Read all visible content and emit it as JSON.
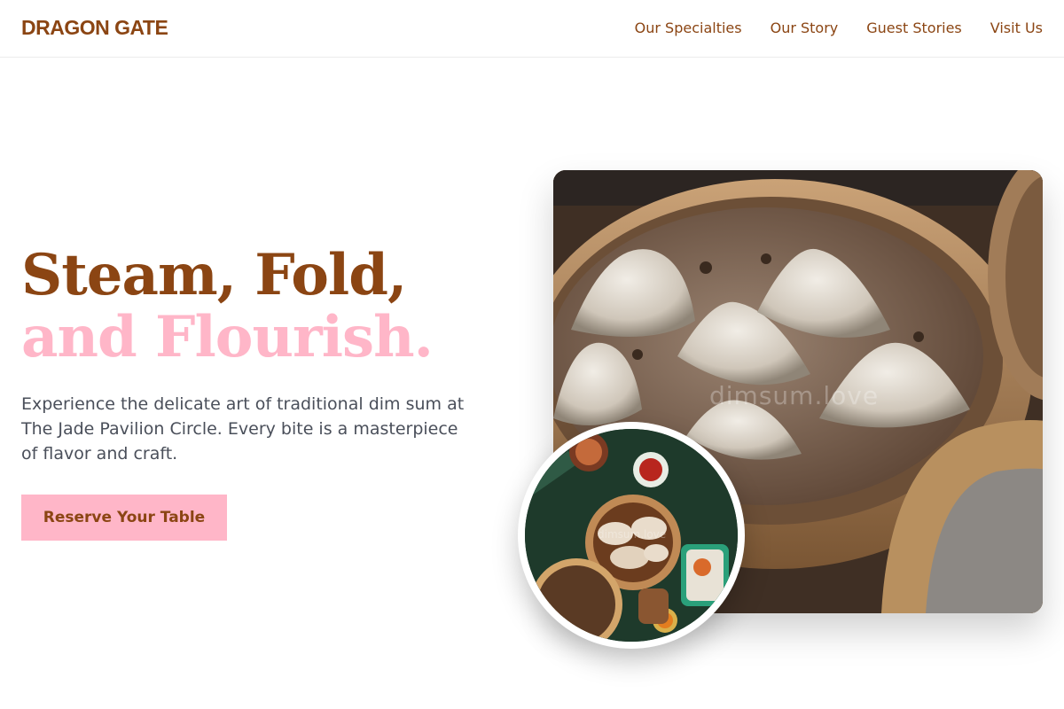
{
  "brand": {
    "name": "DRAGON GATE"
  },
  "nav": {
    "items": [
      {
        "label": "Our Specialties"
      },
      {
        "label": "Our Story"
      },
      {
        "label": "Guest Stories"
      },
      {
        "label": "Visit Us"
      }
    ]
  },
  "hero": {
    "headline_line1": "Steam, Fold,",
    "headline_line2": "and Flourish.",
    "description": "Experience the delicate art of traditional dim sum at The Jade Pavilion Circle. Every bite is a masterpiece of flavor and craft.",
    "cta_label": "Reserve Your Table",
    "photo_watermark": "dimsum.love",
    "inset_watermark": "dimsum.love"
  },
  "colors": {
    "brand_brown": "#8b4513",
    "accent_pink": "#ffb6c8",
    "body_text": "#4a4f5a"
  }
}
